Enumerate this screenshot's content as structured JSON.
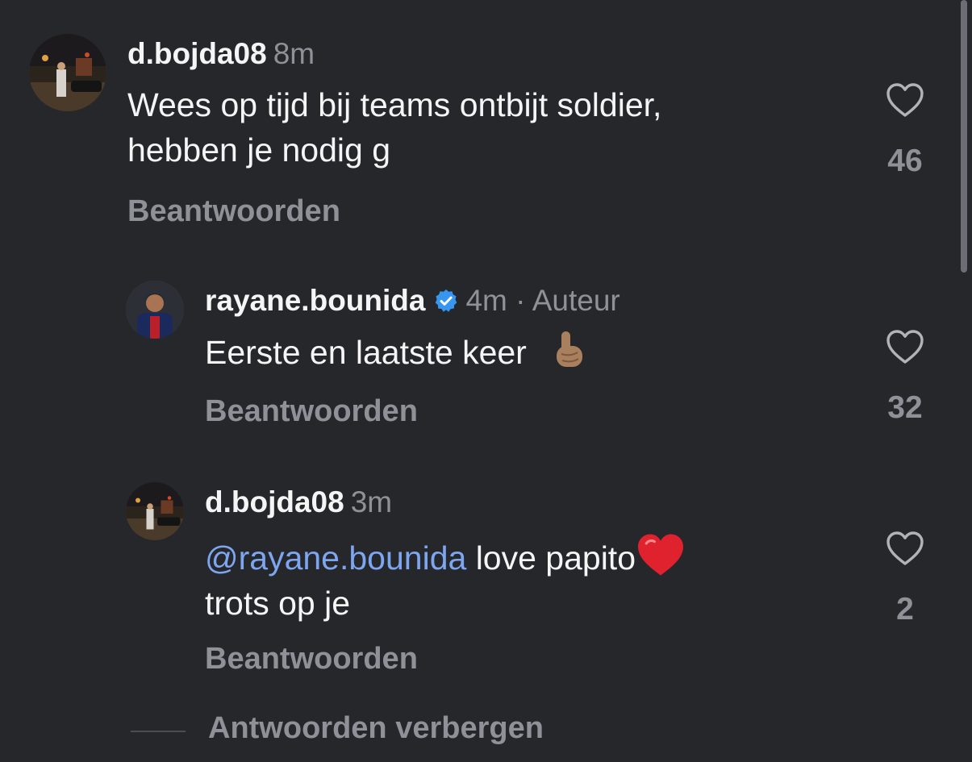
{
  "comments": [
    {
      "username": "d.bojda08",
      "time": "8m",
      "text_line1": "Wees op tijd bij teams ontbijt soldier,",
      "text_line2": "hebben je nodig g",
      "reply_label": "Beantwoorden",
      "likes": "46"
    },
    {
      "username": "rayane.bounida",
      "verified": true,
      "time": "4m",
      "separator": "·",
      "author_label": "Auteur",
      "text": "Eerste en laatste keer",
      "reply_label": "Beantwoorden",
      "likes": "32"
    },
    {
      "username": "d.bojda08",
      "time": "3m",
      "mention": "@rayane.bounida",
      "text_line1": " love papito",
      "text_line2": "trots op je",
      "reply_label": "Beantwoorden",
      "likes": "2"
    }
  ],
  "hide_replies_label": "Antwoorden verbergen",
  "colors": {
    "background": "#25272b",
    "muted": "#8e9197",
    "mention": "#7ea6f0",
    "verified": "#3797f0",
    "heart_emoji": "#e0212e"
  },
  "icons": {
    "like": "heart-outline-icon",
    "verified": "verified-badge-icon",
    "emoji_1": "index-pointing-up-emoji",
    "emoji_2": "red-heart-emoji"
  }
}
